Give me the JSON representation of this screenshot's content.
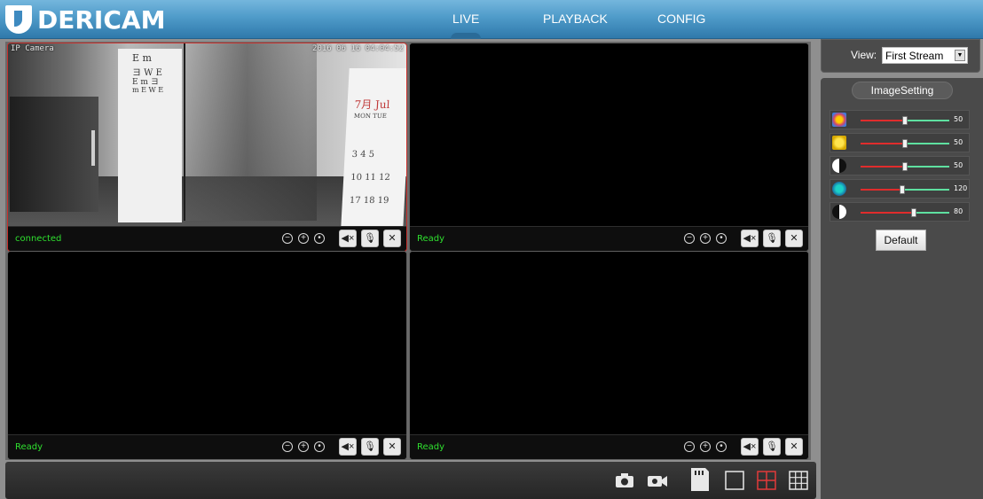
{
  "header": {
    "brand": "DERICAM",
    "nav": [
      {
        "label": "LIVE",
        "active": true
      },
      {
        "label": "PLAYBACK"
      },
      {
        "label": "CONFIG"
      }
    ]
  },
  "view": {
    "label": "View:",
    "selected": "First Stream"
  },
  "image_setting": {
    "title": "ImageSetting",
    "sliders": [
      {
        "icon": "hue-icon",
        "value": "50",
        "fraction": 0.5
      },
      {
        "icon": "brightness-icon",
        "value": "50",
        "fraction": 0.5
      },
      {
        "icon": "contrast-icon",
        "value": "50",
        "fraction": 0.5
      },
      {
        "icon": "saturation-icon",
        "value": "120",
        "fraction": 0.47
      },
      {
        "icon": "sharpness-icon",
        "value": "80",
        "fraction": 0.6
      }
    ],
    "default_label": "Default"
  },
  "cells": [
    {
      "status": "connected",
      "osd_left": "IP Camera",
      "osd_right": "2016 06 16 04:04:52"
    },
    {
      "status": "Ready"
    },
    {
      "status": "Ready"
    },
    {
      "status": "Ready"
    }
  ],
  "camera_scene": {
    "chart_lines": [
      "E m",
      "ヨ W E",
      "E m ヨ",
      "m E W E"
    ],
    "calendar": [
      "7月 Jul",
      "MON  TUE",
      "3   4   5",
      "10  11  12",
      "17  18  19"
    ]
  },
  "colors": {
    "header_top": "#74b6dd",
    "header_bottom": "#2f79ab",
    "status_green": "#2fe02f",
    "active_border": "#c9302c",
    "layout_active": "#e23a3a"
  },
  "toolbar_icons": [
    "camera-icon",
    "record-icon",
    "sd-card-icon",
    "layout-1-icon",
    "layout-4-icon",
    "layout-9-icon"
  ]
}
